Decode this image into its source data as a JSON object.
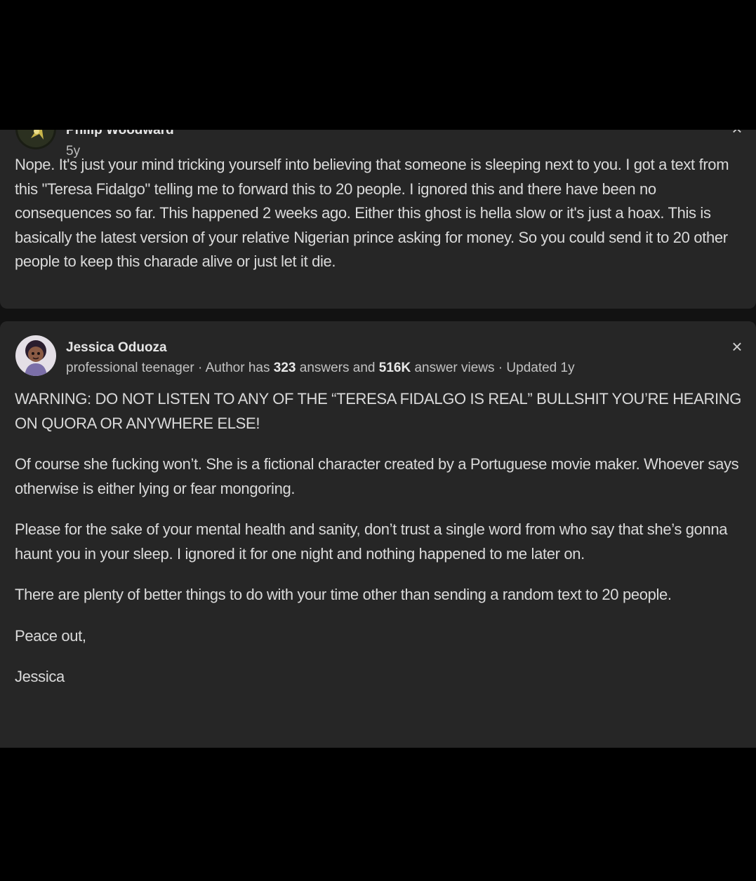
{
  "answers": [
    {
      "author": "Philip Woodward",
      "time": "5y",
      "close_icon": "×",
      "paragraphs": [
        "Nope. It's just your mind tricking yourself into believing that someone is sleeping next to you. I got a text from this \"Teresa Fidalgo\" telling me to forward this to 20 people. I ignored this and there have been no consequences so far. This happened 2 weeks ago. Either this ghost is hella slow or it's just a hoax. This is basically the latest version of your relative Nigerian prince asking for money. So you could send it to 20 other people to keep this charade alive or just let it die."
      ]
    },
    {
      "author": "Jessica Oduoza",
      "credential": "professional teenager",
      "sep1": " · ",
      "stats_prefix": "Author has ",
      "answers_count": "323",
      "stats_mid": " answers and ",
      "views_count": "516K",
      "stats_suffix": " answer views",
      "sep2": " · ",
      "updated": "Updated 1y",
      "close_icon": "×",
      "paragraphs": [
        "WARNING: DO NOT LISTEN TO ANY OF THE “TERESA FIDALGO IS REAL” BULLSHIT YOU’RE HEARING ON QUORA OR ANYWHERE ELSE!",
        "Of course she fucking won’t. She is a fictional character created by a Portuguese movie maker. Whoever says otherwise is either lying or fear mongoring.",
        "Please for the sake of your mental health and sanity, don’t trust a single word from who say that she’s gonna haunt you in your sleep. I ignored it for one night and nothing happened to me later on.",
        "There are plenty of better things to do with your time other than sending a random text to 20 people.",
        "Peace out,",
        "Jessica"
      ]
    }
  ]
}
